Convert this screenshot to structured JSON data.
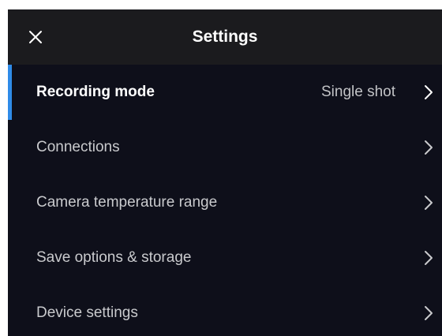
{
  "header": {
    "title": "Settings",
    "close_icon": "close-icon"
  },
  "settings": {
    "items": [
      {
        "label": "Recording mode",
        "value": "Single shot",
        "selected": true
      },
      {
        "label": "Connections"
      },
      {
        "label": "Camera temperature range"
      },
      {
        "label": "Save options & storage"
      },
      {
        "label": "Device settings"
      }
    ]
  },
  "colors": {
    "background": "#0e0f1a",
    "header_background": "#1b1b1e",
    "accent": "#2f8be8",
    "text_primary": "#ffffff",
    "text_secondary": "#c9cacd"
  },
  "icons": {
    "row_chevron": "chevron-right-icon"
  }
}
